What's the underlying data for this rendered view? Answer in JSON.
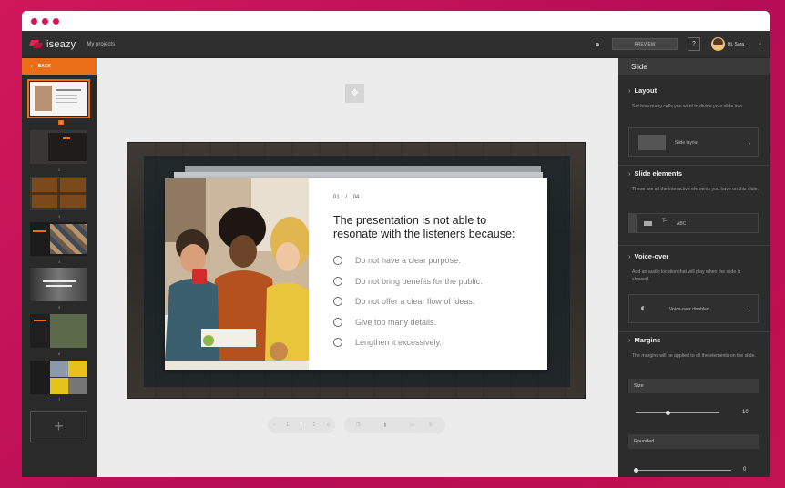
{
  "app": {
    "logo_text": "iseazy",
    "nav_link": "My projects",
    "preview_label": "PREVIEW",
    "help_label": "?",
    "user_greeting": "Hi, Sara"
  },
  "left": {
    "back_label": "BACK",
    "add_label": "+",
    "thumbnails": [
      {
        "num": "1",
        "active": true
      },
      {
        "num": "2"
      },
      {
        "num": "3"
      },
      {
        "num": "4"
      },
      {
        "num": "5"
      },
      {
        "num": "6"
      },
      {
        "num": "7"
      }
    ]
  },
  "question": {
    "current": "01",
    "separator": "/",
    "total": "04",
    "title": "The presentation is not able to resonate with the listeners because:",
    "options": [
      "Do not have a clear purpose.",
      "Do not bring benefits for the public.",
      "Do not offer a clear flow of ideas.",
      "Give too many details.",
      "Lengthen it excessively."
    ]
  },
  "pager": {
    "current": "1",
    "separator": "/",
    "total": "2"
  },
  "right": {
    "header": "Slide",
    "layout": {
      "title": "Layout",
      "desc": "Set how many cells you want to divide your slide into.",
      "box_label": "Slide layout"
    },
    "elements": {
      "title": "Slide elements",
      "desc": "These are all the interactive elements you have on this slide.",
      "box_label": "ABC"
    },
    "voiceover": {
      "title": "Voice-over",
      "desc": "Add an audio locution that will play when the slide is showed.",
      "box_label": "Voice-over disabled"
    },
    "margins": {
      "title": "Margins",
      "desc": "The margins will be applied to all the elements on the slide.",
      "size_label": "Size",
      "size_value": "10",
      "size_level": 0.35,
      "rounded_label": "Rounded",
      "rounded_value": "0",
      "rounded_level": 0
    }
  },
  "colors": {
    "accent": "#ea6d18",
    "brand": "#d0185a",
    "logo": "#e3254f"
  }
}
